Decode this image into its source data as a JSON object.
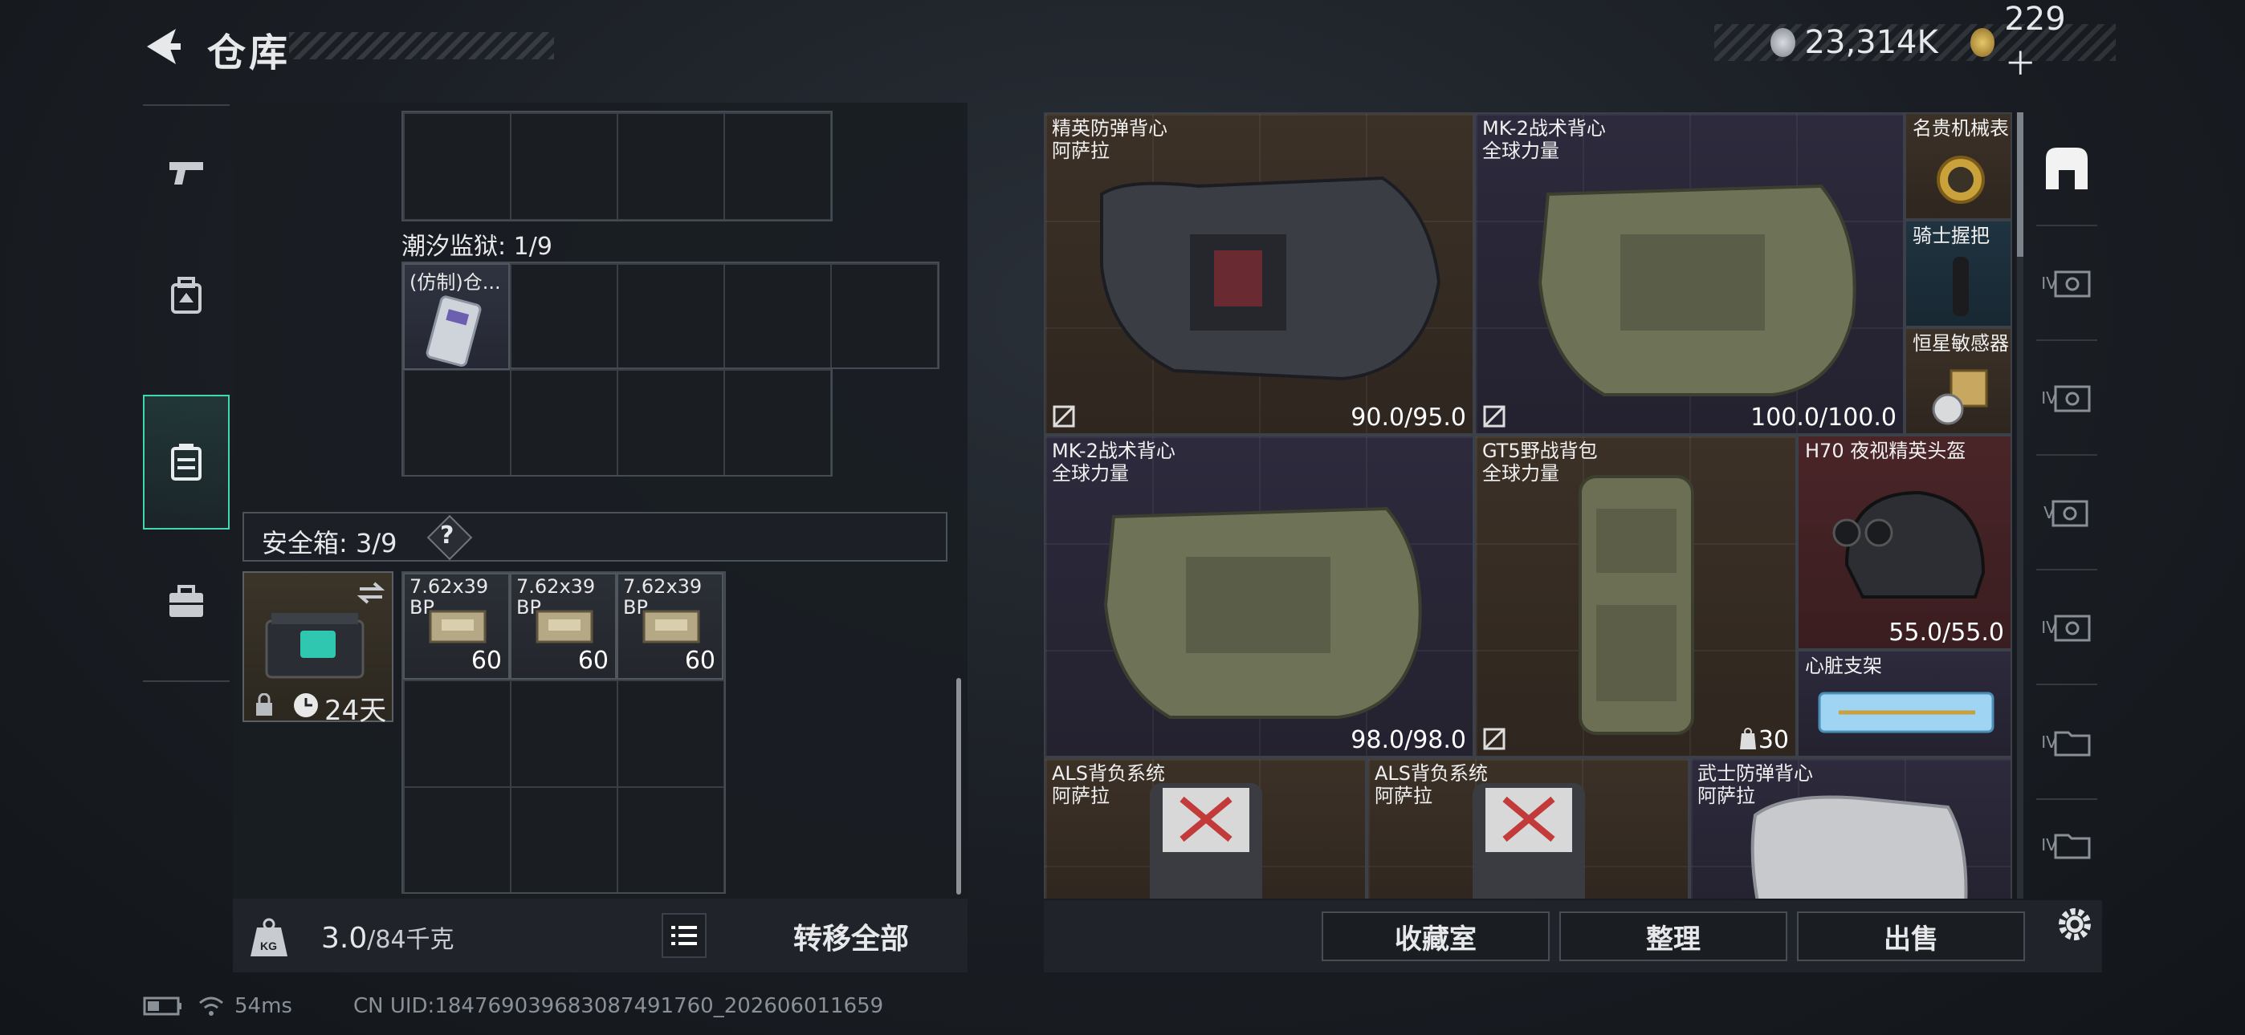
{
  "header": {
    "title": "仓库",
    "currency": [
      {
        "icon": "silver-coin-icon",
        "value": "23,314K"
      },
      {
        "icon": "gold-triangle-coin-icon",
        "value": "229＋"
      }
    ]
  },
  "left_nav": {
    "items": [
      {
        "icon": "pistol-icon"
      },
      {
        "icon": "backpack-vest-icon"
      },
      {
        "icon": "container-icon",
        "active": true
      },
      {
        "icon": "briefcase-icon"
      }
    ]
  },
  "inventory": {
    "tidal_prison_label": "潮汐监狱: 1/9",
    "tidal_item_label": "(仿制)仓...",
    "safe_box_label": "安全箱: 3/9",
    "safe_help": "?",
    "safe_box_days": "24天",
    "ammo": [
      {
        "name": "7.62x39 BP",
        "qty": "60"
      },
      {
        "name": "7.62x39 BP",
        "qty": "60"
      },
      {
        "name": "7.62x39 BP",
        "qty": "60"
      }
    ]
  },
  "footer_left": {
    "weight_value": "3.0",
    "weight_max": "/84千克",
    "transfer_all": "转移全部"
  },
  "stash": {
    "items": [
      {
        "name": "精英防弹背心",
        "brand": "阿萨拉",
        "durability": "90.0/95.0",
        "bg": "brown"
      },
      {
        "name": "MK-2战术背心",
        "brand": "全球力量",
        "durability": "100.0/100.0",
        "bg": "purple"
      },
      {
        "name": "名贵机械表",
        "bg": "brown"
      },
      {
        "name": "骑士握把",
        "bg": "blue"
      },
      {
        "name": "恒星敏感器",
        "bg": "brown"
      },
      {
        "name": "MK-2战术背心",
        "brand": "全球力量",
        "durability": "98.0/98.0",
        "bg": "purple"
      },
      {
        "name": "GT5野战背包",
        "brand": "全球力量",
        "count": "30",
        "bg": "brown"
      },
      {
        "name": "H70 夜视精英头盔",
        "durability": "55.0/55.0",
        "bg": "red"
      },
      {
        "name": "心脏支架",
        "bg": "purple"
      },
      {
        "name": "ALS背负系统",
        "brand": "阿萨拉",
        "bg": "brown"
      },
      {
        "name": "ALS背负系统",
        "brand": "阿萨拉",
        "bg": "brown"
      },
      {
        "name": "武士防弹背心",
        "brand": "阿萨拉",
        "bg": "purple"
      }
    ]
  },
  "right_nav": {
    "tiers": [
      "",
      "IV",
      "IV",
      "V",
      "IV",
      "IV",
      "IV"
    ]
  },
  "footer_right": {
    "collection": "收藏室",
    "sort": "整理",
    "sell": "出售"
  },
  "status": {
    "ping": "54ms",
    "uid": "CN UID:18476903968308749176​0_202606011659"
  }
}
